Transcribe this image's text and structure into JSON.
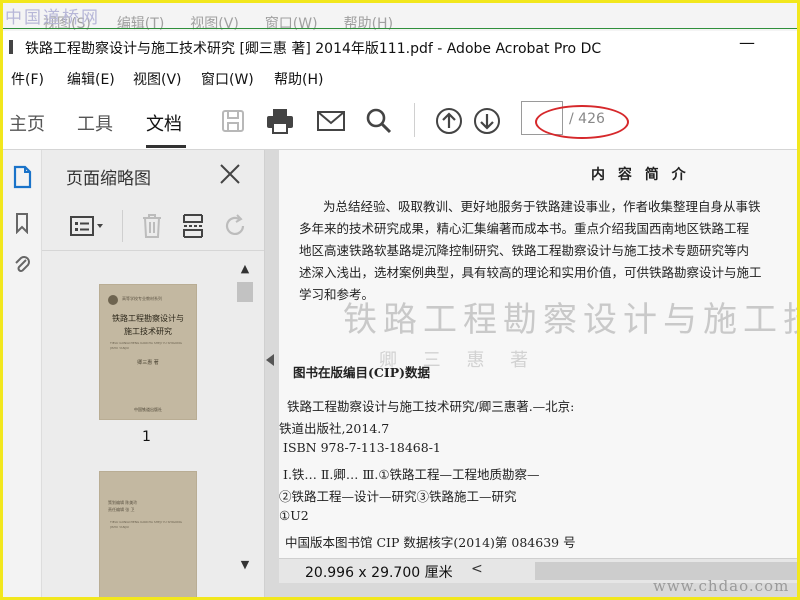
{
  "watermark_top": "中国道桥网",
  "watermark_bottom": "www.chdao.com",
  "ghost_menu": [
    "视图(S)",
    "编辑(T)",
    "视图(V)",
    "窗口(W)",
    "帮助(H)"
  ],
  "window": {
    "title": "铁路工程勘察设计与施工技术研究 [卿三惠 著] 2014年版111.pdf - Adobe Acrobat Pro DC",
    "minimize": "—"
  },
  "menu": [
    "件(F)",
    "编辑(E)",
    "视图(V)",
    "窗口(W)",
    "帮助(H)"
  ],
  "tabs": {
    "home": "主页",
    "tools": "工具",
    "document": "文档"
  },
  "toolbar_icons": [
    "save-icon",
    "print-icon",
    "mail-icon",
    "search-icon",
    "page-up-icon",
    "page-down-icon"
  ],
  "page_nav": {
    "current": "",
    "total": "/ 426"
  },
  "thumb_panel": {
    "title": "页面缩略图",
    "page1_label": "1"
  },
  "book_cover": {
    "series": "高等学校专业教材系列",
    "title_line1": "铁路工程勘察设计与",
    "title_line2": "施工技术研究",
    "english": "TIELU GONGCHENG KANCHA SHEJI YU SHIGONG JISHU YANJIU",
    "author": "卿三惠 著",
    "publisher": "中国铁道出版社"
  },
  "book_cover2": {
    "line1": "策划编辑 陈美玲",
    "line2": "责任编辑 张 卫",
    "english": "TIELU GONGCHENG KANCHA SHEJI YU SHIGONG JISHU YANJIU"
  },
  "doc_page": {
    "heading": "内 容 简 介",
    "intro_lines": [
      "为总结经验、吸取教训、更好地服务于铁路建设事业，作者收集整理自身从事铁",
      "多年来的技术研究成果，精心汇集编著而成本书。重点介绍我国西南地区铁路工程",
      "地区高速铁路软基路堤沉降控制研究、铁路工程勘察设计与施工技术专题研究等内",
      "述深入浅出，选材案例典型，具有较高的理论和实用价值，可供铁路勘察设计与施工",
      "学习和参考。"
    ],
    "ghost_title": "铁路工程勘察设计与施工技术研究",
    "ghost_sub": "卿 三 惠 著",
    "cip_heading": "图书在版编目(CIP)数据",
    "cip_lines": [
      "铁路工程勘察设计与施工技术研究/卿三惠著.—北京:",
      "铁道出版社,2014.7",
      "ISBN 978-7-113-18468-1",
      "Ⅰ.铁…   Ⅱ.卿…   Ⅲ.①铁路工程—工程地质勘察—",
      "②铁路工程—设计—研究③铁路施工—研究",
      "①U2",
      "中国版本图书馆 CIP 数据核字(2014)第 084639 号"
    ]
  },
  "status": {
    "page_size": "20.996 x 29.700 厘米",
    "scroll_left": "<"
  },
  "colors": {
    "highlight_ellipse": "#d6282b",
    "frame_border": "#f2e71d",
    "green_rule": "#2f8f3b"
  }
}
